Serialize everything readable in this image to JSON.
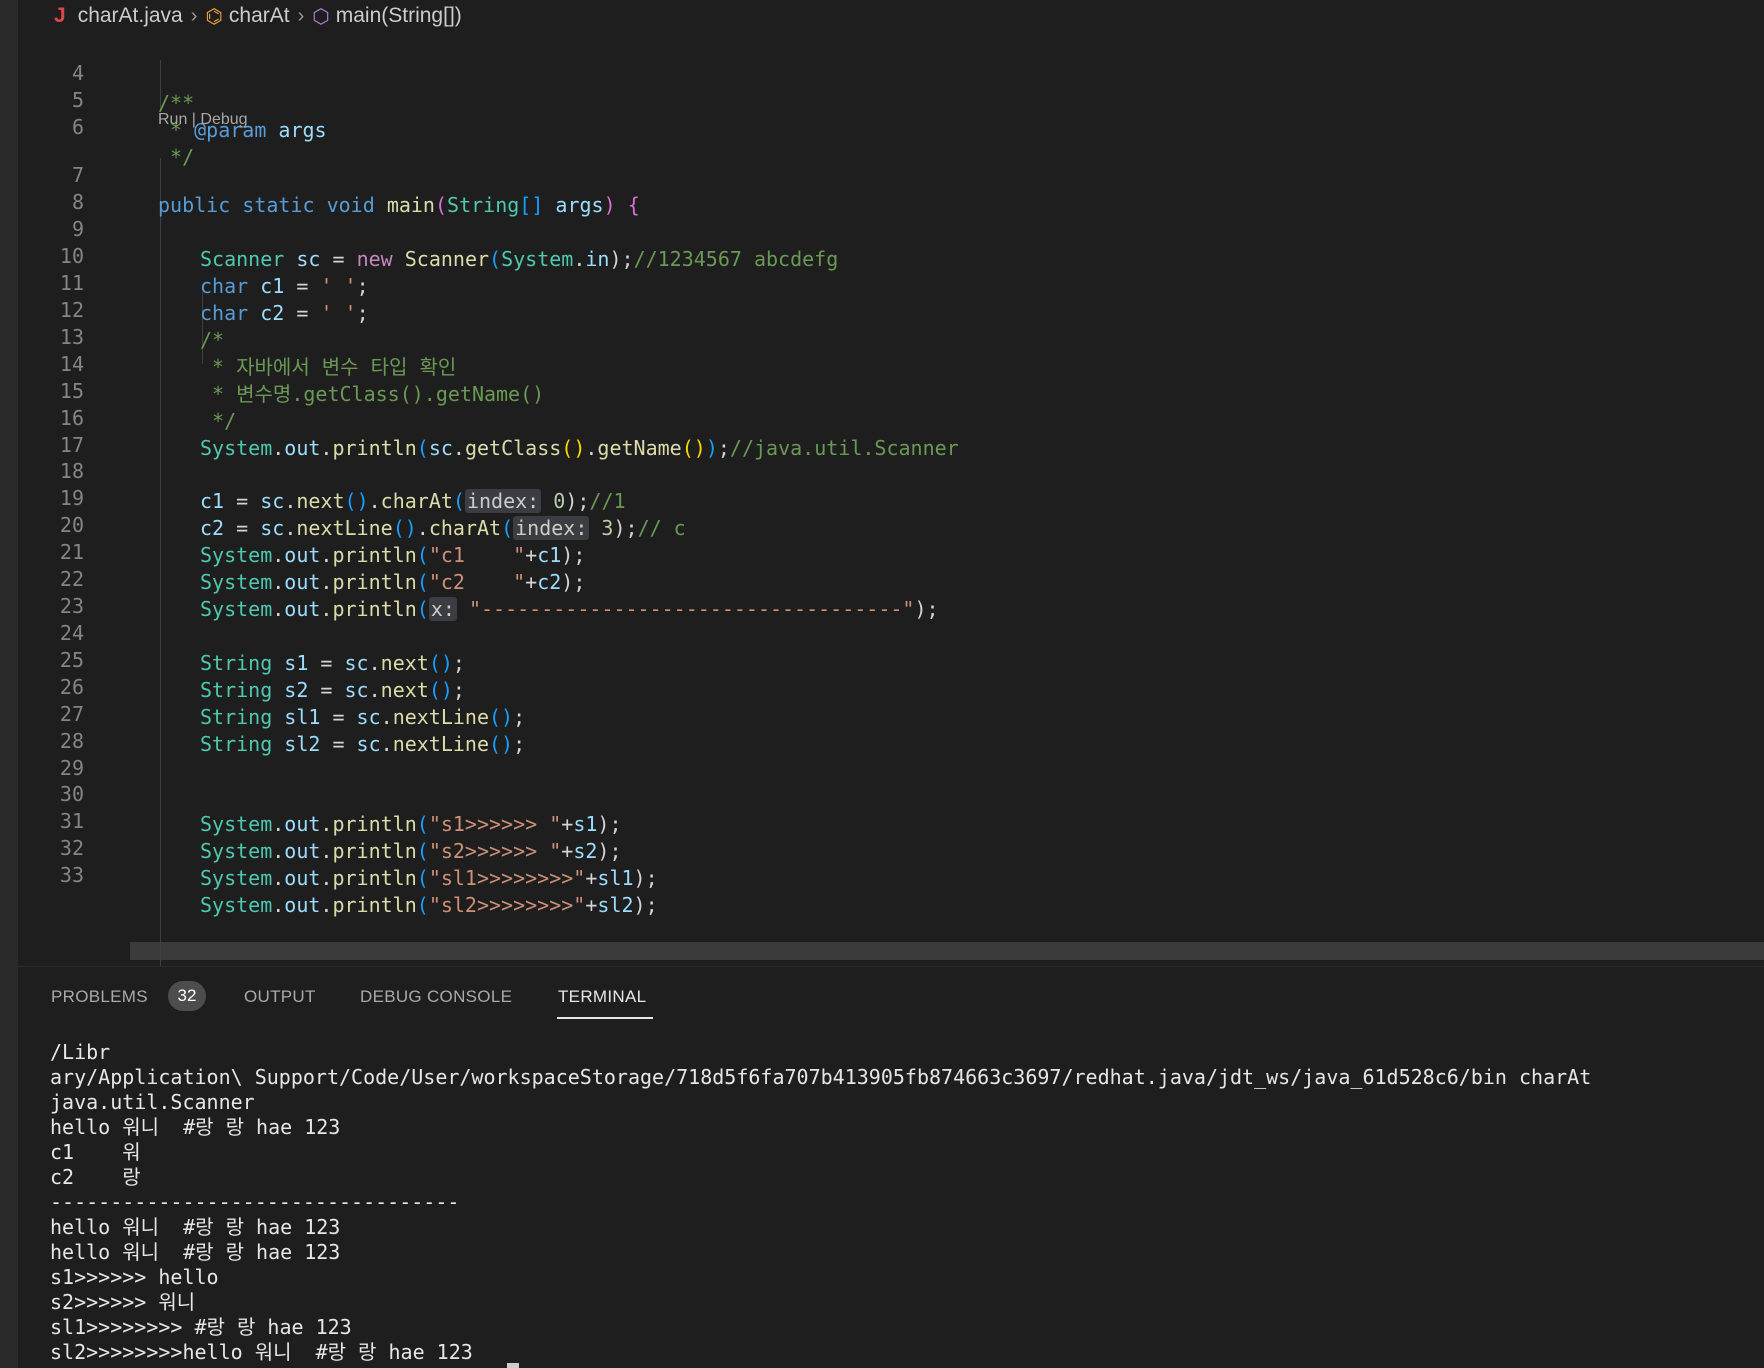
{
  "breadcrumb": {
    "file": "charAt.java",
    "class": "charAt",
    "method": "main(String[])",
    "icons": [
      "java-file-icon",
      "class-icon",
      "method-cube-icon",
      "chevron-right-icon"
    ]
  },
  "editor": {
    "codelens": "Run | Debug",
    "line_numbers": [
      "4",
      "5",
      "6",
      "7",
      "8",
      "9",
      "10",
      "11",
      "12",
      "13",
      "14",
      "15",
      "16",
      "17",
      "18",
      "19",
      "20",
      "21",
      "22",
      "23",
      "24",
      "25",
      "26",
      "27",
      "28",
      "29",
      "30",
      "31",
      "32",
      "33"
    ],
    "lines": {
      "l4": "/**",
      "l5a": " * ",
      "l5b": "@param",
      "l5c": " args",
      "l6": " */",
      "l7": [
        "public",
        " ",
        "static",
        " ",
        "void",
        " ",
        "main",
        "(",
        "String",
        "[]",
        " ",
        "args",
        ")",
        " ",
        "{"
      ],
      "l9": [
        "Scanner",
        " ",
        "sc",
        " = ",
        "new",
        " ",
        "Scanner",
        "(",
        "System",
        ".",
        "in",
        ");",
        "//1234567 abcdefg"
      ],
      "l10": [
        "char",
        " ",
        "c1",
        " = ",
        "' '",
        ";"
      ],
      "l11": [
        "char",
        " ",
        "c2",
        " = ",
        "' '",
        ";"
      ],
      "l12": "/*",
      "l13": " * 자바에서 변수 타입 확인",
      "l14": " * 변수명.getClass().getName()",
      "l15": " */",
      "l16": [
        "System",
        ".",
        "out",
        ".",
        "println",
        "(",
        "sc",
        ".",
        "getClass",
        "()",
        ".",
        "getName",
        "()",
        ")",
        ";",
        "//java.util.Scanner"
      ],
      "l18": [
        "c1",
        " = ",
        "sc",
        ".",
        "next",
        "()",
        ".",
        "charAt",
        "(",
        "index:",
        " ",
        "0",
        ");",
        "//1"
      ],
      "l19": [
        "c2",
        " = ",
        "sc",
        ".",
        "nextLine",
        "()",
        ".",
        "charAt",
        "(",
        "index:",
        " ",
        "3",
        ");",
        "// c"
      ],
      "l20": [
        "System",
        ".",
        "out",
        ".",
        "println",
        "(",
        "\"c1    \"",
        "+",
        "c1",
        ");"
      ],
      "l21": [
        "System",
        ".",
        "out",
        ".",
        "println",
        "(",
        "\"c2    \"",
        "+",
        "c2",
        ");"
      ],
      "l22": [
        "System",
        ".",
        "out",
        ".",
        "println",
        "(",
        "x:",
        " ",
        "\"-----------------------------------\"",
        ");"
      ],
      "l24": [
        "String",
        " ",
        "s1",
        " = ",
        "sc",
        ".",
        "next",
        "()",
        ";"
      ],
      "l25": [
        "String",
        " ",
        "s2",
        " = ",
        "sc",
        ".",
        "next",
        "()",
        ";"
      ],
      "l26": [
        "String",
        " ",
        "sl1",
        " = ",
        "sc",
        ".",
        "nextLine",
        "()",
        ";"
      ],
      "l27": [
        "String",
        " ",
        "sl2",
        " = ",
        "sc",
        ".",
        "nextLine",
        "()",
        ";"
      ],
      "l30": [
        "System",
        ".",
        "out",
        ".",
        "println",
        "(",
        "\"s1>>>>>> \"",
        "+",
        "s1",
        ");"
      ],
      "l31": [
        "System",
        ".",
        "out",
        ".",
        "println",
        "(",
        "\"s2>>>>>> \"",
        "+",
        "s2",
        ");"
      ],
      "l32": [
        "System",
        ".",
        "out",
        ".",
        "println",
        "(",
        "\"sl1>>>>>>>>\"",
        "+",
        "sl1",
        ");"
      ],
      "l33": [
        "System",
        ".",
        "out",
        ".",
        "println",
        "(",
        "\"sl2>>>>>>>>\"",
        "+",
        "sl2",
        ");"
      ]
    }
  },
  "panel": {
    "tabs": [
      "PROBLEMS",
      "OUTPUT",
      "DEBUG CONSOLE",
      "TERMINAL"
    ],
    "problems_count": "32",
    "active_tab": "TERMINAL"
  },
  "terminal": {
    "lines": [
      "/Libr",
      "ary/Application\\ Support/Code/User/workspaceStorage/718d5f6fa707b413905fb874663c3697/redhat.java/jdt_ws/java_61d528c6/bin charAt",
      "java.util.Scanner",
      "hello 워니  #랑 랑 hae 123",
      "c1    워",
      "c2    랑",
      "----------------------------------",
      "hello 워니  #랑 랑 hae 123",
      "hello 워니  #랑 랑 hae 123",
      "s1>>>>>> hello",
      "s2>>>>>> 워니",
      "sl1>>>>>>>> #랑 랑 hae 123",
      "sl2>>>>>>>>hello 워니  #랑 랑 hae 123"
    ]
  },
  "colors": {
    "background": "#1e1e1e",
    "keyword": "#569cd6",
    "control_keyword": "#c586c0",
    "type": "#4ec9b0",
    "variable": "#9cdcfe",
    "function": "#dcdcaa",
    "string": "#ce9178",
    "comment": "#6a9955",
    "number": "#b5cea8"
  }
}
